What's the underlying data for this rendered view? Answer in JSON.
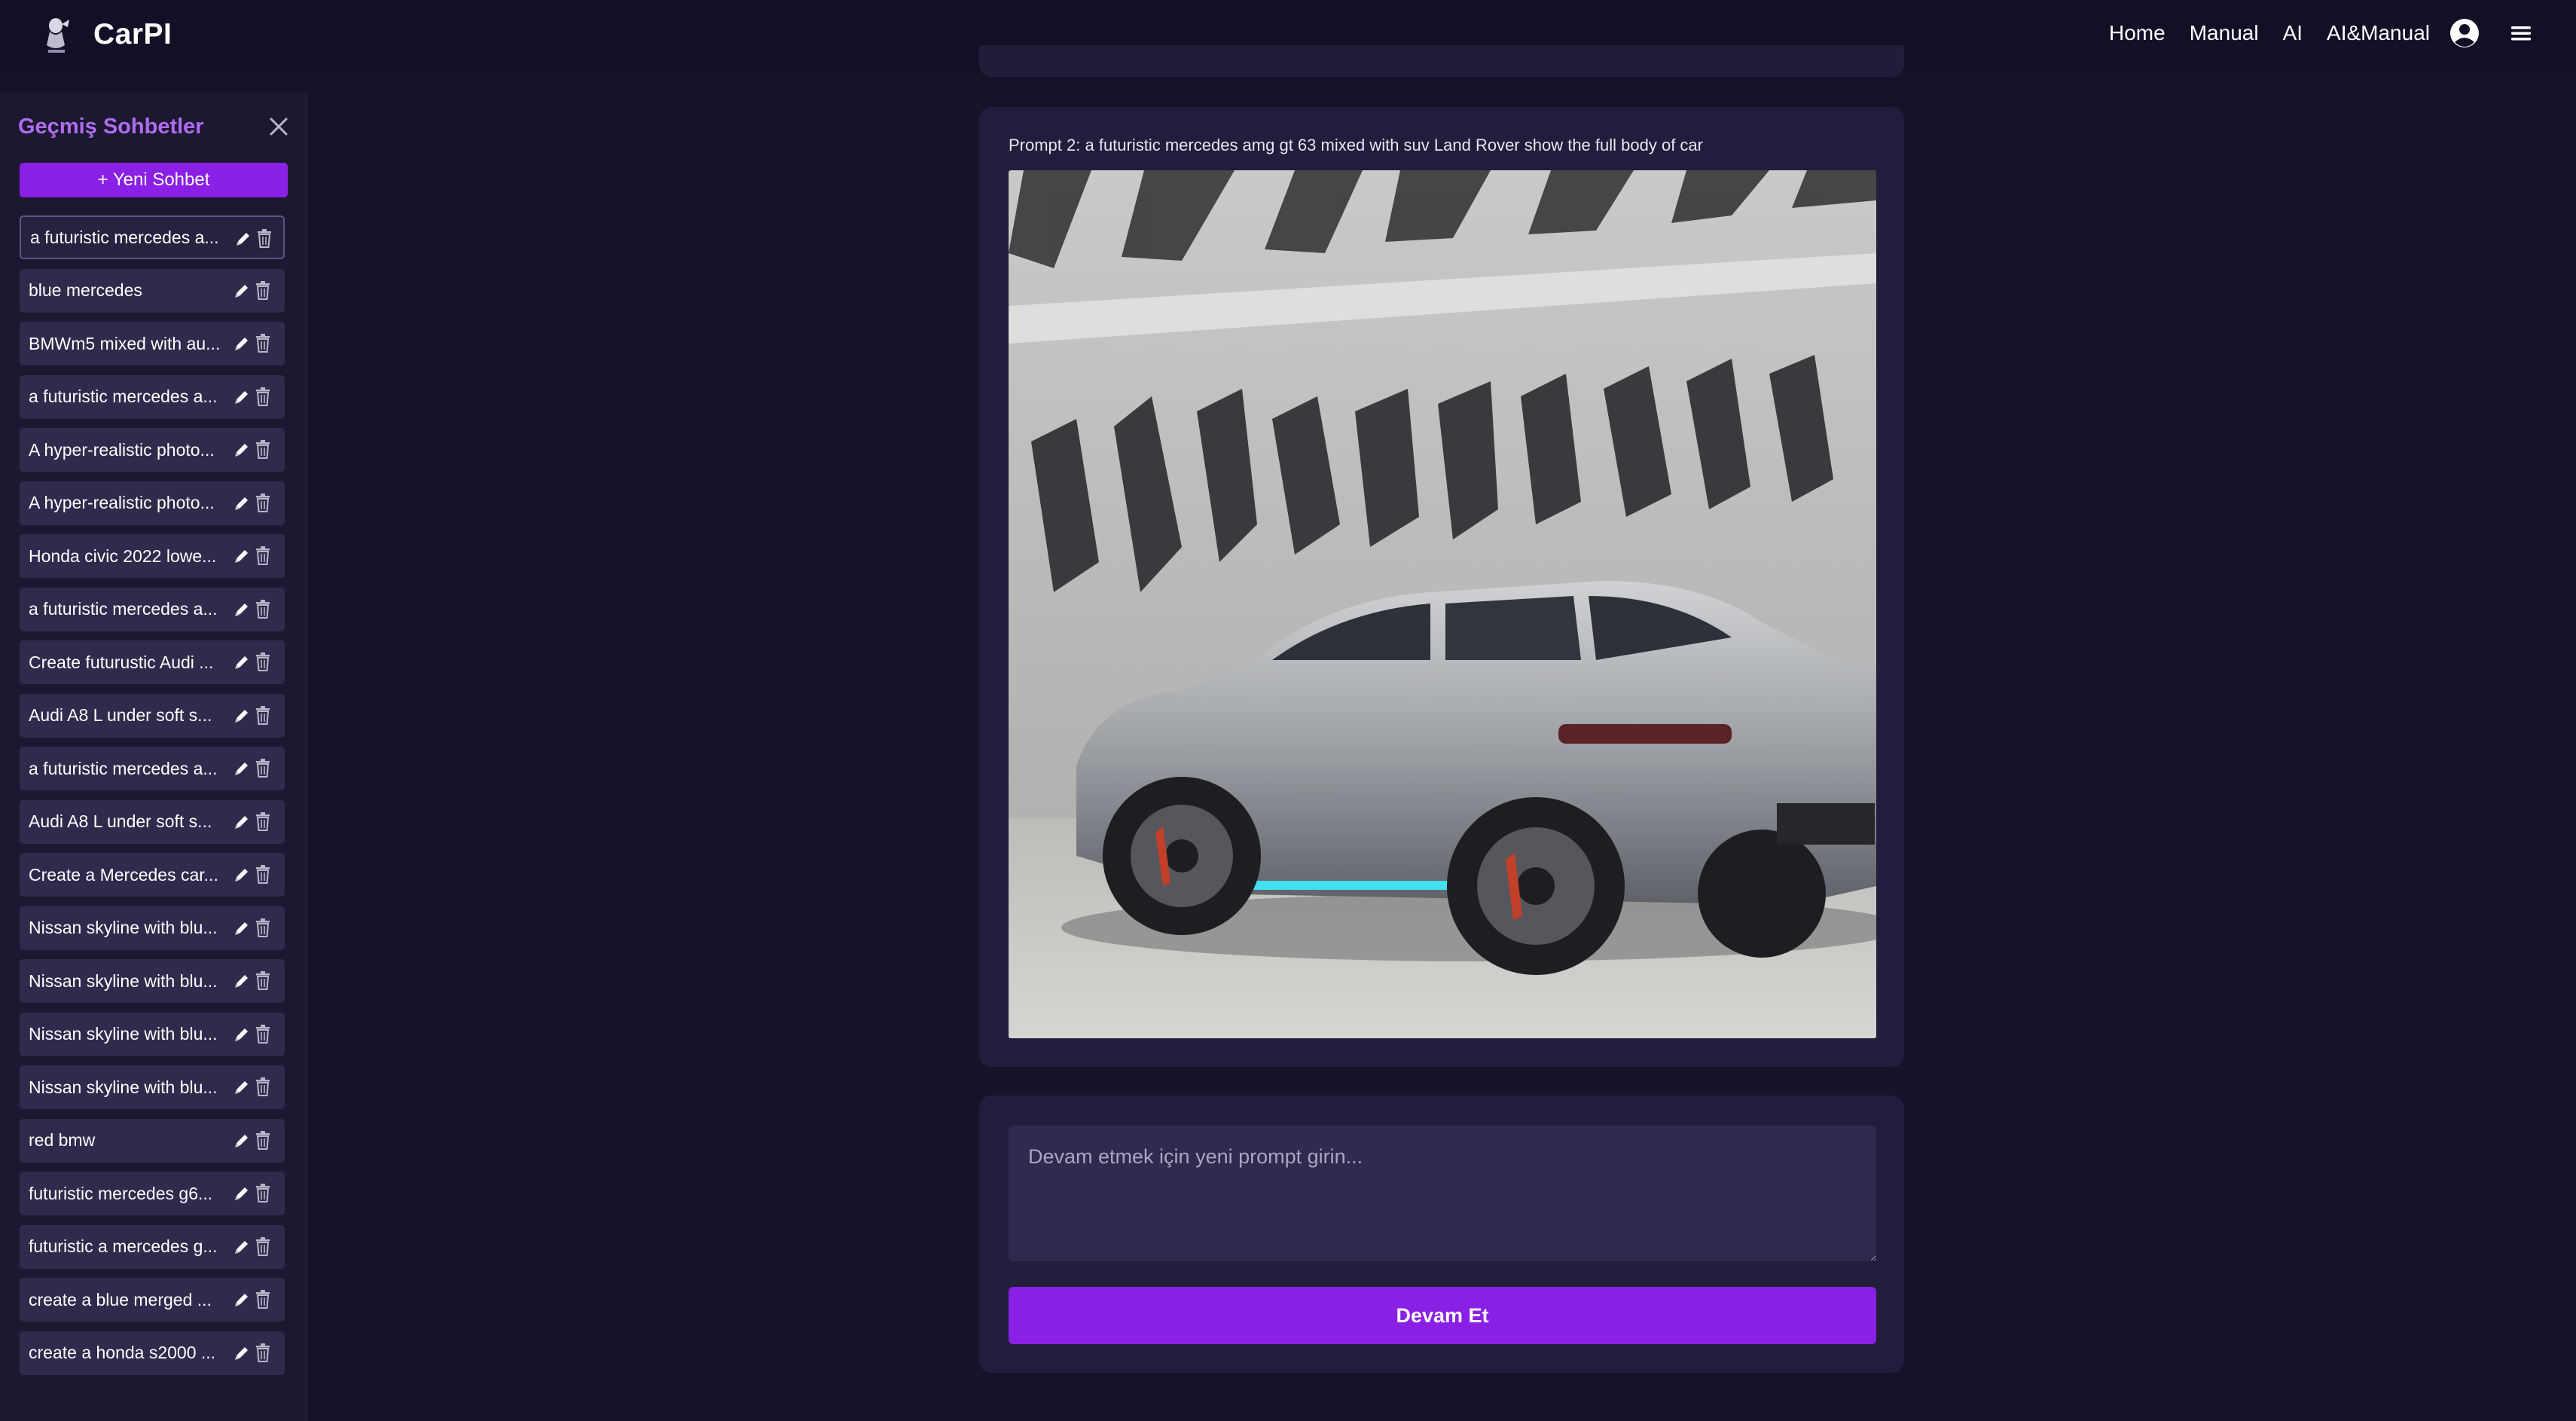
{
  "header": {
    "brand": "CarPI",
    "nav": [
      "Home",
      "Manual",
      "AI",
      "AI&Manual"
    ],
    "icons": {
      "user": "user-circle-icon",
      "menu": "hamburger-menu-icon",
      "logo": "brand-logo-icon"
    }
  },
  "sidebar": {
    "title": "Geçmiş Sohbetler",
    "new_chat": "+ Yeni Sohbet",
    "items": [
      "a futuristic mercedes a...",
      "blue mercedes",
      "BMWm5 mixed with au...",
      "a futuristic mercedes a...",
      "A hyper-realistic photo...",
      "A hyper-realistic photo...",
      "Honda civic 2022 lowe...",
      "a futuristic mercedes a...",
      "Create futurustic Audi ...",
      "Audi A8 L under soft s...",
      "a futuristic mercedes a...",
      "Audi A8 L under soft s...",
      "Create a Mercedes car...",
      "Nissan skyline with blu...",
      "Nissan skyline with blu...",
      "Nissan skyline with blu...",
      "Nissan skyline with blu...",
      "red bmw",
      "futuristic mercedes g6...",
      "futuristic a mercedes g...",
      "create a blue merged ...",
      "create a honda s2000 ..."
    ],
    "icons": {
      "close": "close-icon",
      "edit": "pencil-icon",
      "delete": "trash-icon"
    }
  },
  "main": {
    "prompt": "Prompt 2: a futuristic mercedes amg gt 63 mixed with suv Land Rover show the full body of car",
    "input_placeholder": "Devam etmek için yeni prompt girin...",
    "continue": "Devam Et"
  },
  "colors": {
    "background": "#151329",
    "nav": "#121026",
    "sidebar": "#1b1831",
    "card": "#221d3c",
    "accent": "#8a20e6",
    "sidebar_title": "#b06cf0"
  }
}
